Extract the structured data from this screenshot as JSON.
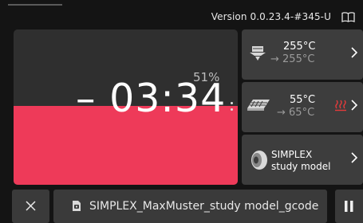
{
  "header": {
    "version": "Version 0.0.23.4-#345-U",
    "manual_icon": "book-icon"
  },
  "progress": {
    "percent_label": "51%",
    "fraction": 0.51,
    "remaining_time": "– 03:34",
    "fill_color": "#ee3a59"
  },
  "nozzle": {
    "icon": "nozzle-icon",
    "current": "255°C",
    "target": "→ 255°C"
  },
  "bed": {
    "icon": "heated-bed-icon",
    "current": "55°C",
    "target": "→ 65°C",
    "heating_icon": "heating-waves-icon",
    "heating_color": "#e53b3b"
  },
  "material": {
    "icon": "filament-spool-icon",
    "line1": "SIMPLEX",
    "line2": "study model"
  },
  "footer": {
    "cancel_icon": "close-icon",
    "file_icon": "gcode-file-icon",
    "file_name": "SIMPLEX_MaxMuster_study model_gcode",
    "pause_icon": "pause-icon"
  }
}
